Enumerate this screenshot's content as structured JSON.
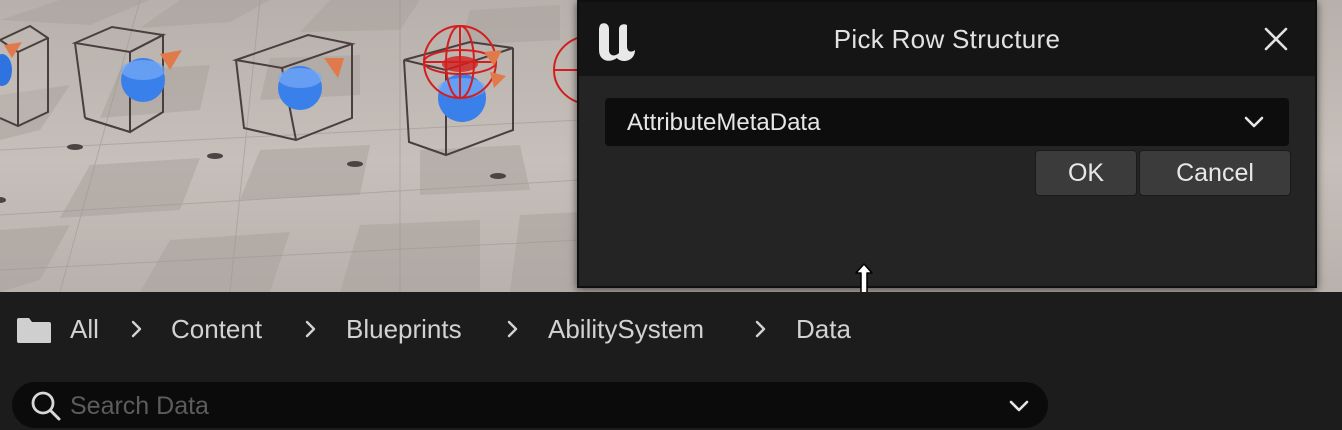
{
  "dialog": {
    "title": "Pick Row Structure",
    "selected_structure": "AttributeMetaData",
    "ok_label": "OK",
    "cancel_label": "Cancel"
  },
  "breadcrumb": {
    "items": [
      "All",
      "Content",
      "Blueprints",
      "AbilitySystem",
      "Data"
    ]
  },
  "search": {
    "placeholder": "Search Data",
    "value": ""
  },
  "icons": {
    "logo": "unreal-engine-logo-icon",
    "close": "close-icon",
    "dropdown": "chevron-down-icon",
    "folder": "folder-icon",
    "separator": "chevron-right-icon",
    "search": "search-icon",
    "cursor": "resize-vertical-cursor-icon"
  },
  "colors": {
    "dialog_bg": "#242424",
    "titlebar_bg": "#151515",
    "field_bg": "#0d0d0d",
    "button_bg": "#3b3b3b",
    "panel_bg": "#1c1c1c",
    "selected_gizmo": "#d41e1e",
    "sphere_blue": "#2f73e0",
    "floor": "#c2bbb6"
  }
}
